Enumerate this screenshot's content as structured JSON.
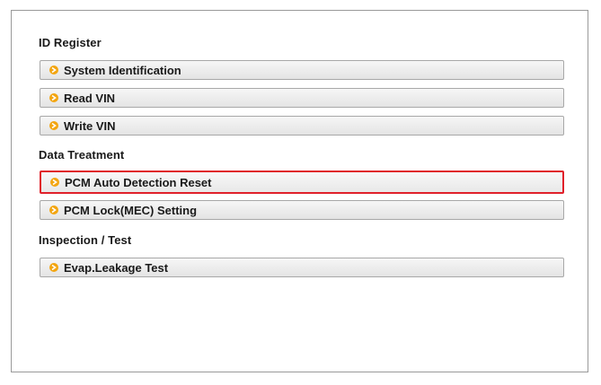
{
  "sections": [
    {
      "title": "ID Register",
      "items": [
        {
          "label": "System Identification",
          "icon": "arrow-right-icon"
        },
        {
          "label": "Read VIN",
          "icon": "arrow-right-icon"
        },
        {
          "label": "Write VIN",
          "icon": "arrow-right-icon"
        }
      ]
    },
    {
      "title": "Data Treatment",
      "items": [
        {
          "label": "PCM Auto Detection Reset",
          "icon": "arrow-right-icon",
          "selected": true
        },
        {
          "label": "PCM Lock(MEC) Setting",
          "icon": "arrow-right-icon"
        }
      ]
    },
    {
      "title": "Inspection / Test",
      "items": [
        {
          "label": "Evap.Leakage Test",
          "icon": "arrow-right-icon"
        }
      ]
    }
  ],
  "colors": {
    "bullet": "#f3a510",
    "selected_border": "#e0202a",
    "item_border": "#a8a8a8",
    "frame_border": "#9a9a9a"
  }
}
